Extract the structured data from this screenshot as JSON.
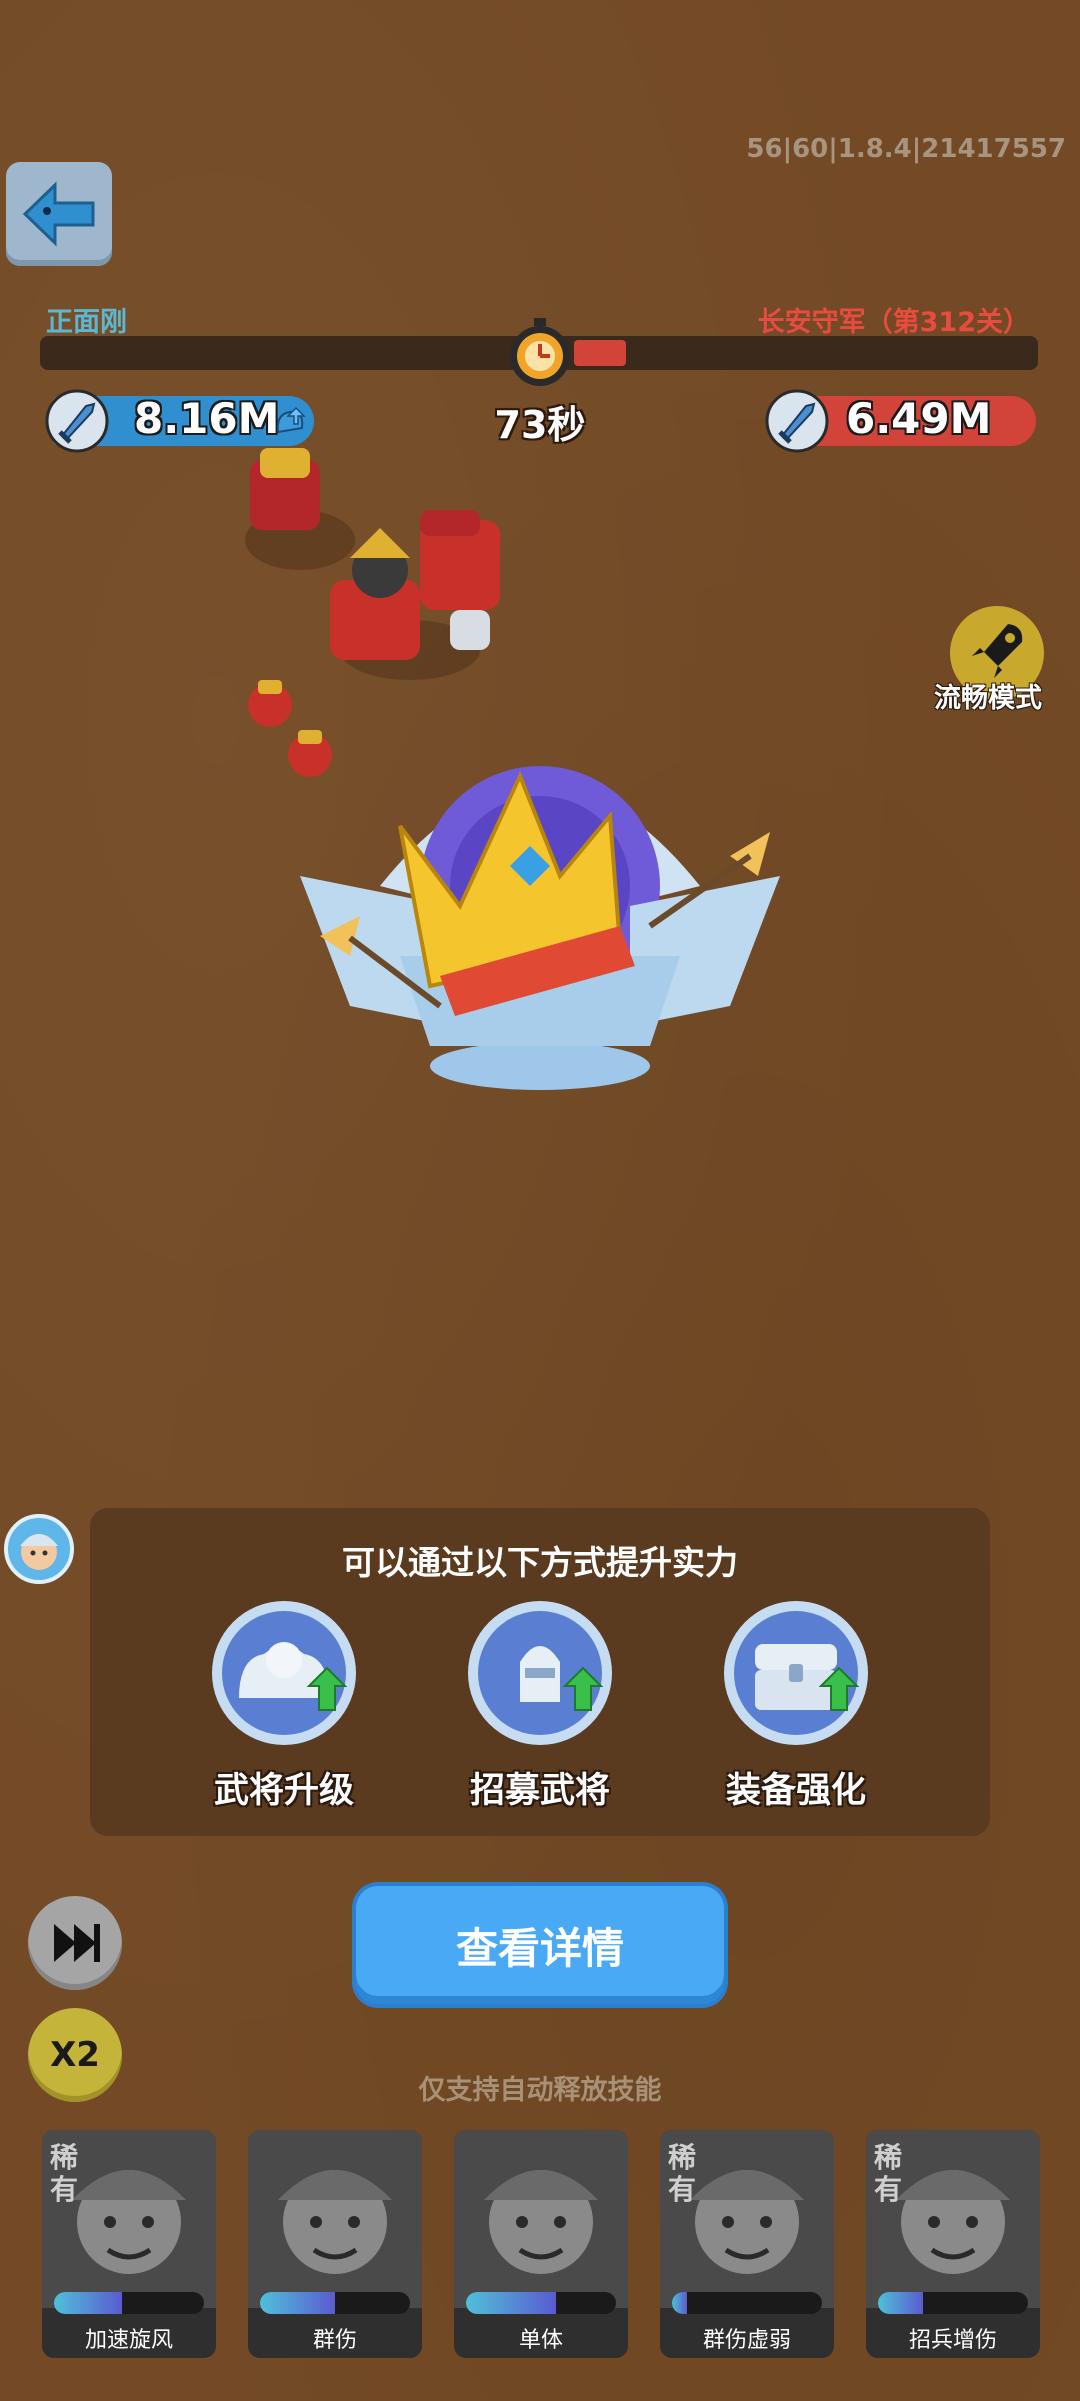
{
  "version_text": "56|60|1.8.4|21417557",
  "battle": {
    "player_name": "正面刚",
    "enemy_name": "长安守军（第312关）",
    "timer": "73秒",
    "player_power": "8.16M",
    "enemy_power": "6.49M",
    "enemy_progress_fraction": 0.05
  },
  "smooth_mode_label": "流畅模式",
  "panel": {
    "title": "可以通过以下方式提升实力",
    "options": [
      {
        "label": "武将升级",
        "icon": "hero-upgrade-icon"
      },
      {
        "label": "招募武将",
        "icon": "recruit-hero-icon"
      },
      {
        "label": "装备强化",
        "icon": "equipment-chest-icon"
      }
    ]
  },
  "detail_button": "查看详情",
  "speed_button": "X2",
  "hint": "仅支持自动释放技能",
  "skills": [
    {
      "label": "加速旋风",
      "rare": "稀有",
      "charge": 0.45
    },
    {
      "label": "群伤",
      "rare": "",
      "charge": 0.5
    },
    {
      "label": "单体",
      "rare": "",
      "charge": 0.6
    },
    {
      "label": "群伤虚弱",
      "rare": "稀有",
      "charge": 0.1
    },
    {
      "label": "招兵增伤",
      "rare": "稀有",
      "charge": 0.3
    }
  ],
  "colors": {
    "background": "#734a25",
    "player": "#2f8fcf",
    "enemy": "#d2443a",
    "primary_button": "#4aa9f5"
  }
}
